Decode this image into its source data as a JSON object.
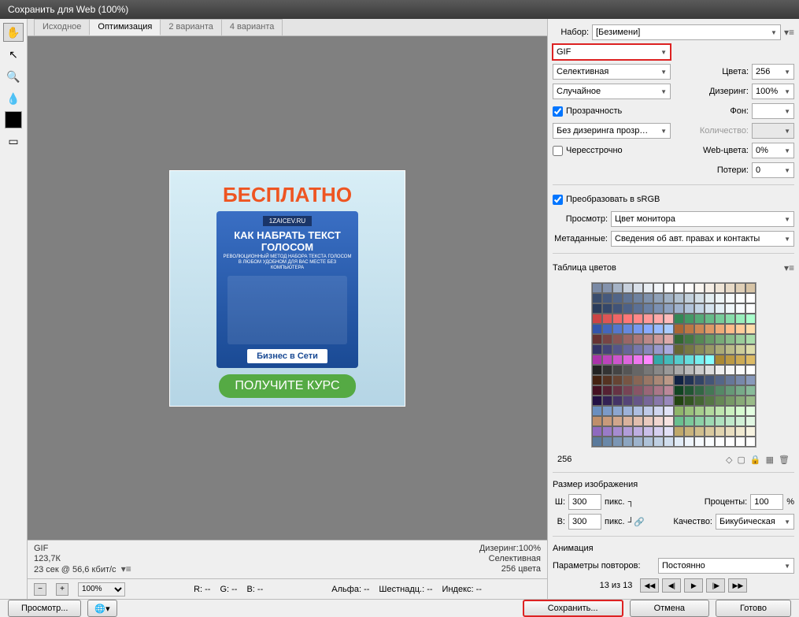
{
  "title": "Сохранить для Web (100%)",
  "tabs": [
    "Исходное",
    "Оптимизация",
    "2 варианта",
    "4 варианта"
  ],
  "active_tab_index": 1,
  "preview": {
    "headline": "БЕСПЛАТНО",
    "box_domain": "1ZAICEV.RU",
    "box_title": "КАК НАБРАТЬ ТЕКСТ ГОЛОСОМ",
    "box_sub": "РЕВОЛЮЦИОННЫЙ МЕТОД НАБОРА ТЕКСТА ГОЛОСОМ В ЛЮБОМ УДОБНОМ ДЛЯ ВАС МЕСТЕ БЕЗ КОМПЬЮТЕРА",
    "box_footer": "Бизнес в Сети",
    "banner": "ПОЛУЧИТЕ КУРС"
  },
  "info": {
    "format": "GIF",
    "size": "123,7К",
    "time": "23 сек @ 56,6 кбит/с",
    "dither": "Дизеринг:100%",
    "palette": "Селективная",
    "colors": "256 цвета"
  },
  "status": {
    "zoom": "100%",
    "r": "R: --",
    "g": "G: --",
    "b": "B: --",
    "alpha": "Альфа: --",
    "hex": "Шестнадц.: --",
    "index": "Индекс: --"
  },
  "settings": {
    "preset_label": "Набор:",
    "preset": "[Безимени]",
    "format": "GIF",
    "reduction": "Селективная",
    "colors_label": "Цвета:",
    "colors": "256",
    "dither_method": "Случайное",
    "dither_label": "Дизеринг:",
    "dither": "100%",
    "transparency": "Прозрачность",
    "matte_label": "Фон:",
    "trans_dither": "Без дизеринга прозр…",
    "amount_label": "Количество:",
    "interlaced": "Чересстрочно",
    "websnap_label": "Web-цвета:",
    "websnap": "0%",
    "lossy_label": "Потери:",
    "lossy": "0",
    "srgb": "Преобразовать в sRGB",
    "preview_label": "Просмотр:",
    "preview": "Цвет монитора",
    "meta_label": "Метаданные:",
    "meta": "Сведения об авт. правах и контакты",
    "table_label": "Таблица цветов",
    "table_count": "256"
  },
  "image_size": {
    "section": "Размер изображения",
    "w_label": "Ш:",
    "w": "300",
    "h_label": "В:",
    "h": "300",
    "unit": "пикс.",
    "percent_label": "Проценты:",
    "percent": "100",
    "percent_unit": "%",
    "quality_label": "Качество:",
    "quality": "Бикубическая"
  },
  "animation": {
    "section": "Анимация",
    "loop_label": "Параметры повторов:",
    "loop": "Постоянно",
    "frames": "13 из 13"
  },
  "footer": {
    "preview": "Просмотр...",
    "save": "Сохранить...",
    "cancel": "Отмена",
    "done": "Готово"
  },
  "color_table": [
    "#7a8aa6",
    "#8493ad",
    "#a5b3c6",
    "#c7d0dc",
    "#d9e0e9",
    "#e8edf2",
    "#f2f5f8",
    "#fbfcfd",
    "#fefefe",
    "#fdfbf9",
    "#f9f5f0",
    "#f4ede4",
    "#eee4d6",
    "#e7dac7",
    "#dfcfb7",
    "#d7c4a6",
    "#3a4d6e",
    "#45597d",
    "#516588",
    "#5f7394",
    "#6e82a0",
    "#7e91ac",
    "#8fa1b8",
    "#a0b1c4",
    "#b1c1d0",
    "#c2d0db",
    "#d3dfe6",
    "#e3edf0",
    "#eef5f7",
    "#f6fafb",
    "#fbfdfd",
    "#ffffff",
    "#2a3c5c",
    "#34476a",
    "#405378",
    "#4d6187",
    "#5b7095",
    "#6a80a4",
    "#7b90b2",
    "#8da1c0",
    "#9fb2cd",
    "#b1c3d9",
    "#c3d4e4",
    "#d5e3ee",
    "#e4eff5",
    "#f0f7fa",
    "#f8fbfd",
    "#fdfefe",
    "#c44",
    "#d55",
    "#e66",
    "#f77",
    "#f88",
    "#f99",
    "#faa",
    "#fbb",
    "#385",
    "#496",
    "#5a7",
    "#6b8",
    "#7c9",
    "#8da",
    "#9eb",
    "#afc",
    "#35a",
    "#46b",
    "#57c",
    "#68d",
    "#79e",
    "#8af",
    "#9bf",
    "#acf",
    "#a63",
    "#b74",
    "#c85",
    "#d96",
    "#ea7",
    "#fb8",
    "#fc9",
    "#fda",
    "#633",
    "#744",
    "#855",
    "#966",
    "#a77",
    "#b88",
    "#c99",
    "#daa",
    "#363",
    "#474",
    "#585",
    "#696",
    "#7a7",
    "#8b8",
    "#9c9",
    "#ada",
    "#336",
    "#447",
    "#558",
    "#669",
    "#77a",
    "#88b",
    "#99c",
    "#aad",
    "#663",
    "#774",
    "#885",
    "#996",
    "#aa7",
    "#bb8",
    "#cc9",
    "#dda",
    "#a3a",
    "#b4b",
    "#c5c",
    "#d6d",
    "#e7e",
    "#f8f",
    "#3aa",
    "#4bb",
    "#5cc",
    "#6dd",
    "#7ee",
    "#8ff",
    "#a83",
    "#b94",
    "#ca5",
    "#db6",
    "#222",
    "#333",
    "#444",
    "#555",
    "#666",
    "#777",
    "#888",
    "#999",
    "#aaa",
    "#bbb",
    "#ccc",
    "#ddd",
    "#eee",
    "#f5f5f5",
    "#fafafa",
    "#fff",
    "#421",
    "#532",
    "#643",
    "#754",
    "#865",
    "#976",
    "#a87",
    "#b98",
    "#124",
    "#235",
    "#346",
    "#457",
    "#568",
    "#679",
    "#78a",
    "#89b",
    "#412",
    "#523",
    "#634",
    "#745",
    "#856",
    "#967",
    "#a78",
    "#b89",
    "#142",
    "#253",
    "#364",
    "#475",
    "#586",
    "#697",
    "#7a8",
    "#8b9",
    "#214",
    "#325",
    "#436",
    "#547",
    "#658",
    "#769",
    "#87a",
    "#98b",
    "#241",
    "#352",
    "#463",
    "#574",
    "#685",
    "#796",
    "#8a7",
    "#9b8",
    "#6a8fbf",
    "#7b9ac8",
    "#8ca6d0",
    "#9db2d9",
    "#aebee1",
    "#bfcae9",
    "#d0d6f0",
    "#e1e3f7",
    "#8fb56a",
    "#9ac17b",
    "#a6cd8c",
    "#b2d99d",
    "#bee5ae",
    "#caf0bf",
    "#d6fbd0",
    "#e3ffe1",
    "#bf8f6a",
    "#c89a7b",
    "#d0a68c",
    "#d9b29d",
    "#e1beae",
    "#e9cabf",
    "#f0d6d0",
    "#f7e3e1",
    "#6abf8f",
    "#7bc89a",
    "#8cd0a6",
    "#9dd9b2",
    "#aee1be",
    "#bfe9ca",
    "#d0f0d6",
    "#e1f7e3",
    "#8f6abf",
    "#9a7bc8",
    "#a68cd0",
    "#b29dd9",
    "#beaee1",
    "#cabfe9",
    "#d6d0f0",
    "#e3e1f7",
    "#bfa86a",
    "#c8b37b",
    "#d0be8c",
    "#d9c99d",
    "#e1d4ae",
    "#e9debf",
    "#f0e9d0",
    "#f7f3e1",
    "#5a7a9c",
    "#6a88a8",
    "#7b96b4",
    "#8ca5c0",
    "#9db3cc",
    "#aec2d8",
    "#c0d0e3",
    "#d1deee",
    "#e2ecf7",
    "#eef4fb",
    "#f5f9fd",
    "#f9fcfe",
    "#fcfdfe",
    "#fefeff",
    "#fefefe",
    "#ffffff"
  ]
}
